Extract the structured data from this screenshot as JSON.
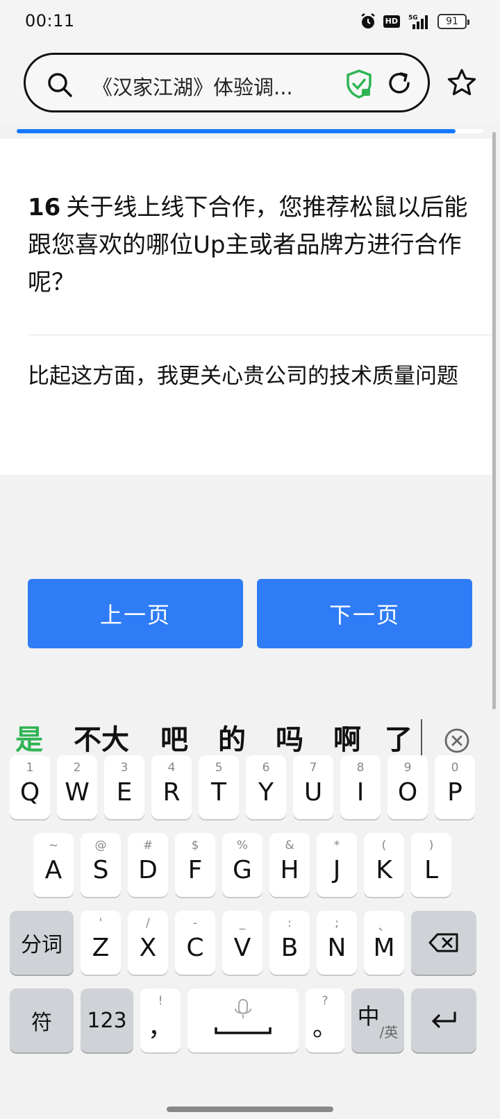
{
  "status_bar": {
    "time": "00:11",
    "hd": "HD",
    "network": "5G",
    "battery": "91"
  },
  "browser": {
    "url_text": "《汉家江湖》体验调...",
    "progress_percent": 94
  },
  "question": {
    "number": "16",
    "text": "关于线上线下合作，您推荐松鼠以后能跟您喜欢的哪位Up主或者品牌方进行合作呢？",
    "answer": "比起这方面，我更关心贵公司的技术质量问题"
  },
  "nav": {
    "prev_label": "上一页",
    "next_label": "下一页"
  },
  "candidates": [
    "是",
    "不大",
    "吧",
    "的",
    "吗",
    "啊",
    "了"
  ],
  "keyboard": {
    "row1": [
      {
        "hint": "1",
        "key": "Q"
      },
      {
        "hint": "2",
        "key": "W"
      },
      {
        "hint": "3",
        "key": "E"
      },
      {
        "hint": "4",
        "key": "R"
      },
      {
        "hint": "5",
        "key": "T"
      },
      {
        "hint": "6",
        "key": "Y"
      },
      {
        "hint": "7",
        "key": "U"
      },
      {
        "hint": "8",
        "key": "I"
      },
      {
        "hint": "9",
        "key": "O"
      },
      {
        "hint": "0",
        "key": "P"
      }
    ],
    "row2": [
      {
        "hint": "~",
        "key": "A"
      },
      {
        "hint": "@",
        "key": "S"
      },
      {
        "hint": "#",
        "key": "D"
      },
      {
        "hint": "$",
        "key": "F"
      },
      {
        "hint": "%",
        "key": "G"
      },
      {
        "hint": "&",
        "key": "H"
      },
      {
        "hint": "*",
        "key": "J"
      },
      {
        "hint": "(",
        "key": "K"
      },
      {
        "hint": ")",
        "key": "L"
      }
    ],
    "row3": [
      {
        "hint": "'",
        "key": "Z"
      },
      {
        "hint": "/",
        "key": "X"
      },
      {
        "hint": "-",
        "key": "C"
      },
      {
        "hint": "_",
        "key": "V"
      },
      {
        "hint": ":",
        "key": "B"
      },
      {
        "hint": ";",
        "key": "N"
      },
      {
        "hint": "、",
        "key": "M"
      }
    ],
    "segment_label": "分词",
    "symbol_label": "符",
    "number_label": "123",
    "comma_hint": "!",
    "comma_key": "，",
    "period_hint": "?",
    "period_key": "。",
    "lang_main": "中",
    "lang_sub": "英"
  },
  "colors": {
    "accent": "#2f7cf6",
    "progress": "#1677ff",
    "candidate_highlight": "#2fb455"
  }
}
